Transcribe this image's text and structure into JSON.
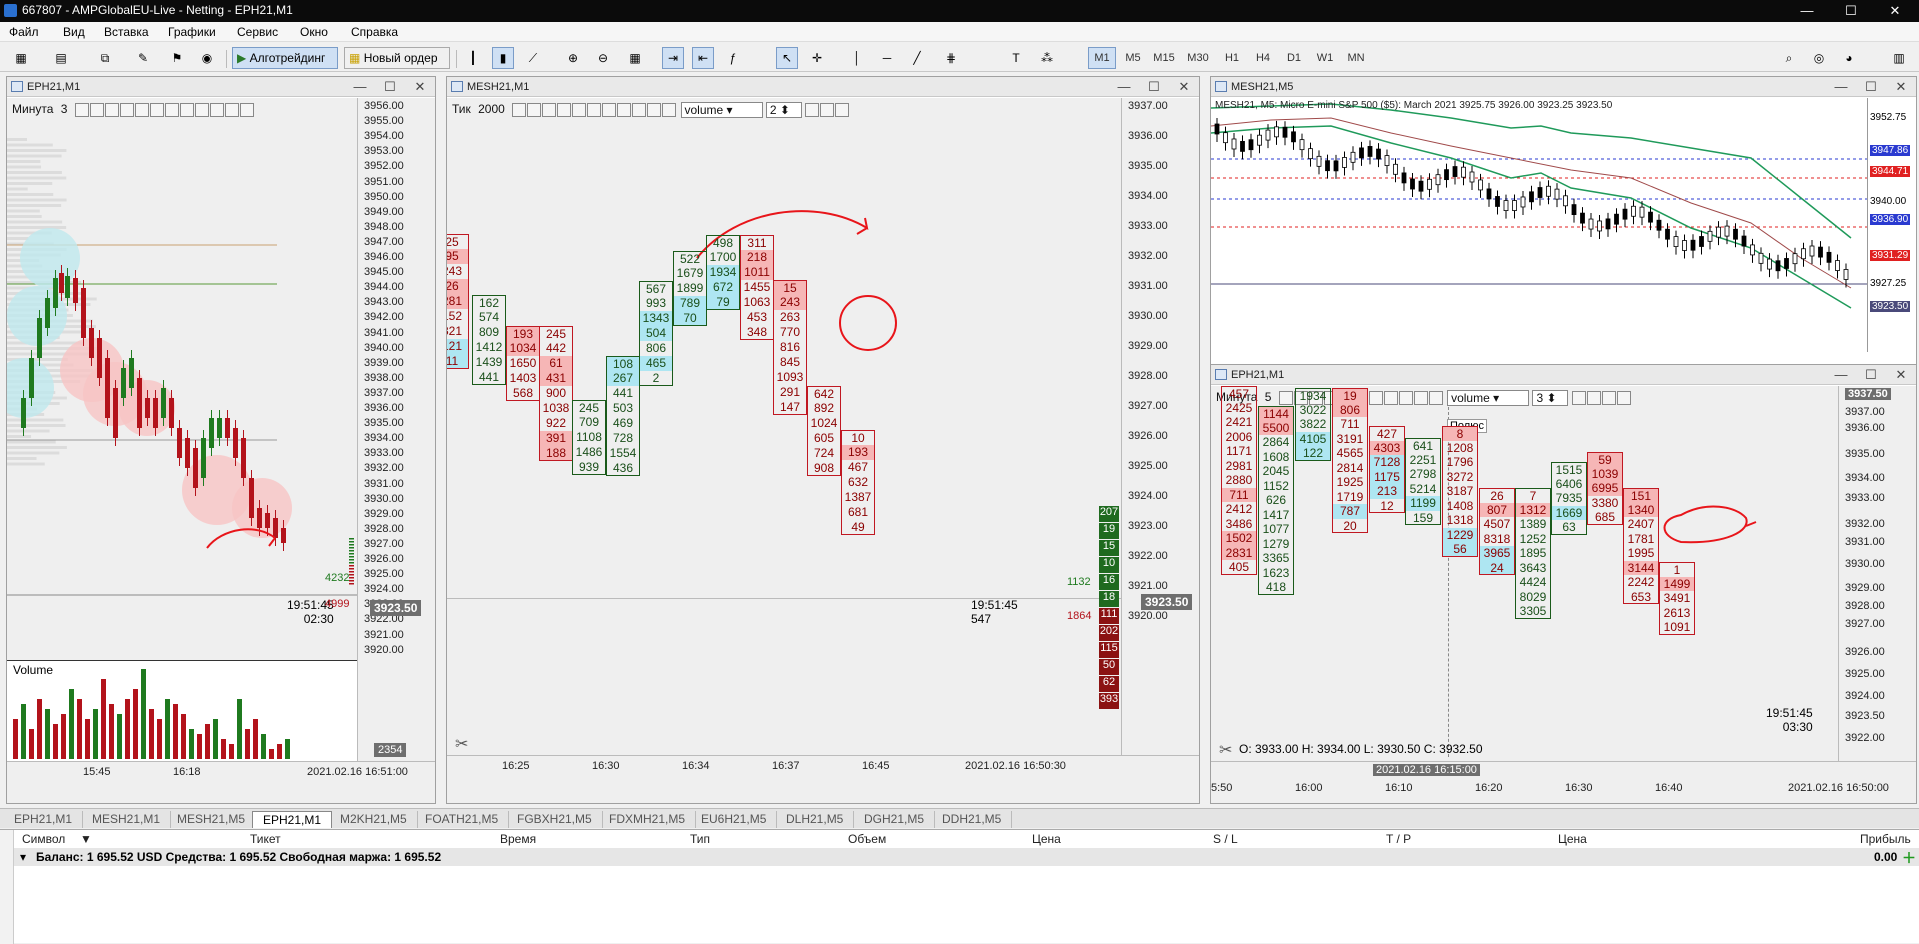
{
  "app": {
    "title": "667807 - AMPGlobalEU-Live - Netting - EPH21,M1",
    "minimize": "—",
    "maximize": "☐",
    "close": "✕"
  },
  "menu": [
    "Файл",
    "Вид",
    "Вставка",
    "Графики",
    "Сервис",
    "Окно",
    "Справка"
  ],
  "toolbar": {
    "algo_label": "Алготрейдинг",
    "new_order_label": "Новый ордер",
    "timeframes": [
      "M1",
      "M5",
      "M15",
      "M30",
      "H1",
      "H4",
      "D1",
      "W1",
      "MN"
    ],
    "active_timeframe": "M1"
  },
  "chart1": {
    "title": "EPH21,M1",
    "overlay_label": "Минута",
    "overlay_value": "3",
    "prices": [
      "3956.00",
      "3955.00",
      "3954.00",
      "3953.00",
      "3952.00",
      "3951.00",
      "3950.00",
      "3949.00",
      "3948.00",
      "3947.00",
      "3946.00",
      "3945.00",
      "3944.00",
      "3943.00",
      "3942.00",
      "3941.00",
      "3940.00",
      "3939.00",
      "3938.00",
      "3937.00",
      "3936.00",
      "3935.00",
      "3934.00",
      "3933.00",
      "3932.00",
      "3931.00",
      "3930.00",
      "3929.00",
      "3928.00",
      "3927.00",
      "3926.00",
      "3925.00",
      "3924.00",
      "3923.00",
      "3922.00",
      "3921.00",
      "3920.00"
    ],
    "current_price": "3923.50",
    "vol_buy": "4232",
    "vol_sell": "4999",
    "clock": "19:51:45",
    "countdown": "02:30",
    "volume_label": "Volume",
    "volume_value": "2354",
    "time_labels": [
      "15:45",
      "16:18"
    ],
    "datetime": "2021.02.16 16:51:00"
  },
  "chart2": {
    "title": "MESH21,M1",
    "overlay_label": "Тик",
    "overlay_value": "2000",
    "dropdown": "volume",
    "dropdown_num": "2",
    "prices": [
      "3937.00",
      "3936.00",
      "3935.00",
      "3934.00",
      "3933.00",
      "3932.00",
      "3931.00",
      "3930.00",
      "3929.00",
      "3928.00",
      "3927.00",
      "3926.00",
      "3925.00",
      "3924.00",
      "3923.00",
      "3922.00",
      "3921.00",
      "3920.00"
    ],
    "current_price": "3923.50",
    "vol_buy": "1132",
    "vol_sell": "1864",
    "dom_green": [
      "207",
      "19",
      "15",
      "10",
      "16",
      "18"
    ],
    "dom_red": [
      "111",
      "202",
      "115",
      "50",
      "62",
      "393"
    ],
    "clock": "19:51:45",
    "countdown": "547",
    "time_labels": [
      "16:25",
      "16:30",
      "16:34",
      "16:37",
      "16:45"
    ],
    "datetime": "2021.02.16 16:50:30",
    "columns": [
      {
        "cells": [
          {
            "v": "25",
            "c": "s"
          },
          {
            "v": "95",
            "c": "s hs"
          },
          {
            "v": "243",
            "c": "s"
          },
          {
            "v": "26",
            "c": "s hs"
          },
          {
            "v": "281",
            "c": "s hs"
          },
          {
            "v": "152",
            "c": "s"
          },
          {
            "v": "321",
            "c": "s"
          },
          {
            "v": "121",
            "c": "s hb"
          },
          {
            "v": "11",
            "c": "s hb"
          }
        ],
        "side": "sell"
      },
      {
        "cells": [
          {
            "v": "162",
            "c": "b"
          },
          {
            "v": "574",
            "c": "b"
          },
          {
            "v": "809",
            "c": "b"
          },
          {
            "v": "1412",
            "c": "b"
          },
          {
            "v": "1439",
            "c": "b"
          },
          {
            "v": "441",
            "c": "b"
          }
        ],
        "side": "buy"
      },
      {
        "cells": [
          {
            "v": "193",
            "c": "s hs"
          },
          {
            "v": "1034",
            "c": "s hs"
          },
          {
            "v": "1650",
            "c": "s"
          },
          {
            "v": "1403",
            "c": "s"
          },
          {
            "v": "568",
            "c": "s"
          }
        ],
        "side": "sell"
      },
      {
        "cells": [
          {
            "v": "245",
            "c": "s"
          },
          {
            "v": "442",
            "c": "s"
          },
          {
            "v": "61",
            "c": "s hs"
          },
          {
            "v": "431",
            "c": "s hs"
          },
          {
            "v": "900",
            "c": "s"
          },
          {
            "v": "1038",
            "c": "s"
          },
          {
            "v": "922",
            "c": "s"
          },
          {
            "v": "391",
            "c": "s hs"
          },
          {
            "v": "188",
            "c": "s hs"
          }
        ],
        "side": "sell"
      },
      {
        "cells": [
          {
            "v": "245",
            "c": "b"
          },
          {
            "v": "709",
            "c": "b"
          },
          {
            "v": "1108",
            "c": "b"
          },
          {
            "v": "1486",
            "c": "b"
          },
          {
            "v": "939",
            "c": "b"
          }
        ],
        "side": "buy"
      },
      {
        "cells": [
          {
            "v": "108",
            "c": "b hb"
          },
          {
            "v": "267",
            "c": "b hb"
          },
          {
            "v": "441",
            "c": "b"
          },
          {
            "v": "503",
            "c": "b"
          },
          {
            "v": "469",
            "c": "b"
          },
          {
            "v": "728",
            "c": "b"
          },
          {
            "v": "1554",
            "c": "b"
          },
          {
            "v": "436",
            "c": "b"
          }
        ],
        "side": "buy"
      },
      {
        "cells": [
          {
            "v": "567",
            "c": "b"
          },
          {
            "v": "993",
            "c": "b"
          },
          {
            "v": "1343",
            "c": "b hb"
          },
          {
            "v": "504",
            "c": "b hb"
          },
          {
            "v": "806",
            "c": "b"
          },
          {
            "v": "465",
            "c": "b hb"
          },
          {
            "v": "2",
            "c": "b"
          }
        ],
        "side": "buy"
      },
      {
        "cells": [
          {
            "v": "522",
            "c": "b"
          },
          {
            "v": "1679",
            "c": "b"
          },
          {
            "v": "1899",
            "c": "b"
          },
          {
            "v": "789",
            "c": "b hb"
          },
          {
            "v": "70",
            "c": "b hb"
          }
        ],
        "side": "buy"
      },
      {
        "cells": [
          {
            "v": "498",
            "c": "b"
          },
          {
            "v": "1700",
            "c": "b"
          },
          {
            "v": "1934",
            "c": "b hb"
          },
          {
            "v": "672",
            "c": "b hb"
          },
          {
            "v": "79",
            "c": "b hb"
          }
        ],
        "side": "buy"
      },
      {
        "cells": [
          {
            "v": "311",
            "c": "s"
          },
          {
            "v": "218",
            "c": "s hs"
          },
          {
            "v": "1011",
            "c": "s hs"
          },
          {
            "v": "1455",
            "c": "s"
          },
          {
            "v": "1063",
            "c": "s"
          },
          {
            "v": "453",
            "c": "s"
          },
          {
            "v": "348",
            "c": "s"
          }
        ],
        "side": "sell"
      },
      {
        "cells": [
          {
            "v": "15",
            "c": "s hs"
          },
          {
            "v": "243",
            "c": "s hs"
          },
          {
            "v": "263",
            "c": "s"
          },
          {
            "v": "770",
            "c": "s"
          },
          {
            "v": "816",
            "c": "s"
          },
          {
            "v": "845",
            "c": "s"
          },
          {
            "v": "1093",
            "c": "s"
          },
          {
            "v": "291",
            "c": "s"
          },
          {
            "v": "147",
            "c": "s"
          }
        ],
        "side": "sell"
      },
      {
        "cells": [
          {
            "v": "642",
            "c": "s"
          },
          {
            "v": "892",
            "c": "s"
          },
          {
            "v": "1024",
            "c": "s"
          },
          {
            "v": "605",
            "c": "s"
          },
          {
            "v": "724",
            "c": "s"
          },
          {
            "v": "908",
            "c": "s"
          }
        ],
        "side": "sell"
      },
      {
        "cells": [
          {
            "v": "10",
            "c": "s"
          },
          {
            "v": "193",
            "c": "s hs"
          },
          {
            "v": "467",
            "c": "s"
          },
          {
            "v": "632",
            "c": "s"
          },
          {
            "v": "1387",
            "c": "s"
          },
          {
            "v": "681",
            "c": "s"
          },
          {
            "v": "49",
            "c": "s"
          }
        ],
        "side": "sell"
      }
    ]
  },
  "chart3": {
    "title": "MESH21,M5",
    "info": "MESH21, M5:  Micro E-mini S&P 500 ($5): March 2021  3925.75 3926.00 3923.25 3923.50",
    "prices": [
      "3952.75",
      "3947.86",
      "3944.71",
      "3940.00",
      "3936.90",
      "3931.29",
      "3927.25",
      "3923.50"
    ],
    "time_labels": [
      "5:50",
      "16:00",
      "16:10",
      "16:20",
      "16:30",
      "16:40"
    ],
    "datetime": "2021.02.16 16:50:00"
  },
  "chart4": {
    "title": "EPH21,M1",
    "overlay_label": "Минута",
    "overlay_value": "5",
    "dropdown": "volume",
    "dropdown_num": "3",
    "tooltip": "Полюс",
    "prices": [
      "3937.50",
      "3937.00",
      "3936.00",
      "3935.00",
      "3934.00",
      "3933.00",
      "3932.00",
      "3931.00",
      "3930.00",
      "3929.00",
      "3928.00",
      "3927.00",
      "3926.00",
      "3925.00",
      "3924.00",
      "3923.50",
      "3922.00"
    ],
    "ohlc": "O: 3933.00   H: 3934.00   L: 3930.50   C: 3932.50",
    "crosshair_time": "2021.02.16 16:15:00",
    "clock": "19:51:45",
    "countdown": "03:30",
    "datetime": "2021.02.16 16:50:00",
    "columns": [
      {
        "cells": [
          {
            "v": "457",
            "c": "s"
          },
          {
            "v": "2425",
            "c": "s"
          },
          {
            "v": "2421",
            "c": "s"
          },
          {
            "v": "2006",
            "c": "s"
          },
          {
            "v": "1171",
            "c": "s"
          },
          {
            "v": "2981",
            "c": "s"
          },
          {
            "v": "2880",
            "c": "s"
          },
          {
            "v": "711",
            "c": "s hs"
          },
          {
            "v": "2412",
            "c": "s"
          },
          {
            "v": "3486",
            "c": "s"
          },
          {
            "v": "1502",
            "c": "s hs"
          },
          {
            "v": "2831",
            "c": "s hs"
          },
          {
            "v": "405",
            "c": "s"
          }
        ],
        "side": "sell"
      },
      {
        "cells": [
          {
            "v": "1144",
            "c": "s hs"
          },
          {
            "v": "5500",
            "c": "s hs"
          },
          {
            "v": "2864",
            "c": "b"
          },
          {
            "v": "1608",
            "c": "b"
          },
          {
            "v": "2045",
            "c": "b"
          },
          {
            "v": "1152",
            "c": "b"
          },
          {
            "v": "626",
            "c": "b"
          },
          {
            "v": "1417",
            "c": "b"
          },
          {
            "v": "1077",
            "c": "b"
          },
          {
            "v": "1279",
            "c": "b"
          },
          {
            "v": "3365",
            "c": "b"
          },
          {
            "v": "1623",
            "c": "b"
          },
          {
            "v": "418",
            "c": "b"
          }
        ],
        "side": "buy"
      },
      {
        "cells": [
          {
            "v": "1934",
            "c": "b"
          },
          {
            "v": "3022",
            "c": "b"
          },
          {
            "v": "3822",
            "c": "b"
          },
          {
            "v": "4105",
            "c": "b hb"
          },
          {
            "v": "122",
            "c": "b hb"
          }
        ],
        "side": "buy"
      },
      {
        "cells": [
          {
            "v": "19",
            "c": "s hs"
          },
          {
            "v": "806",
            "c": "s hs"
          },
          {
            "v": "711",
            "c": "s"
          },
          {
            "v": "3191",
            "c": "s"
          },
          {
            "v": "4565",
            "c": "s"
          },
          {
            "v": "2814",
            "c": "s"
          },
          {
            "v": "1925",
            "c": "s"
          },
          {
            "v": "1719",
            "c": "s"
          },
          {
            "v": "787",
            "c": "s hb"
          },
          {
            "v": "20",
            "c": "s"
          }
        ],
        "side": "sell"
      },
      {
        "cells": [
          {
            "v": "427",
            "c": "s"
          },
          {
            "v": "4303",
            "c": "s hs"
          },
          {
            "v": "7128",
            "c": "s hb"
          },
          {
            "v": "1175",
            "c": "s hb"
          },
          {
            "v": "213",
            "c": "s hb"
          },
          {
            "v": "12",
            "c": "s"
          }
        ],
        "side": "sell"
      },
      {
        "cells": [
          {
            "v": "641",
            "c": "b"
          },
          {
            "v": "2251",
            "c": "b"
          },
          {
            "v": "2798",
            "c": "b"
          },
          {
            "v": "5214",
            "c": "b"
          },
          {
            "v": "1199",
            "c": "b hb"
          },
          {
            "v": "159",
            "c": "b"
          }
        ],
        "side": "buy"
      },
      {
        "cells": [
          {
            "v": "8",
            "c": "s hs"
          },
          {
            "v": "1208",
            "c": "s"
          },
          {
            "v": "1796",
            "c": "s"
          },
          {
            "v": "3272",
            "c": "s"
          },
          {
            "v": "3187",
            "c": "s"
          },
          {
            "v": "1408",
            "c": "s"
          },
          {
            "v": "1318",
            "c": "s"
          },
          {
            "v": "1229",
            "c": "s hb"
          },
          {
            "v": "56",
            "c": "s hb"
          }
        ],
        "side": "sell"
      },
      {
        "cells": [
          {
            "v": "26",
            "c": "s"
          },
          {
            "v": "807",
            "c": "s hs"
          },
          {
            "v": "4507",
            "c": "s"
          },
          {
            "v": "8318",
            "c": "s"
          },
          {
            "v": "3965",
            "c": "s hb"
          },
          {
            "v": "24",
            "c": "s hb"
          }
        ],
        "side": "sell"
      },
      {
        "cells": [
          {
            "v": "7",
            "c": "s"
          },
          {
            "v": "1312",
            "c": "s hs"
          },
          {
            "v": "1389",
            "c": "b"
          },
          {
            "v": "1252",
            "c": "b"
          },
          {
            "v": "1895",
            "c": "b"
          },
          {
            "v": "3643",
            "c": "b"
          },
          {
            "v": "4424",
            "c": "b"
          },
          {
            "v": "8029",
            "c": "b"
          },
          {
            "v": "3305",
            "c": "b"
          }
        ],
        "side": "buy"
      },
      {
        "cells": [
          {
            "v": "1515",
            "c": "b"
          },
          {
            "v": "6406",
            "c": "b"
          },
          {
            "v": "7935",
            "c": "b"
          },
          {
            "v": "1669",
            "c": "b hb"
          },
          {
            "v": "63",
            "c": "b"
          }
        ],
        "side": "buy"
      },
      {
        "cells": [
          {
            "v": "59",
            "c": "s hs"
          },
          {
            "v": "1039",
            "c": "s hs"
          },
          {
            "v": "6995",
            "c": "s hs"
          },
          {
            "v": "3380",
            "c": "s"
          },
          {
            "v": "685",
            "c": "s"
          }
        ],
        "side": "sell"
      },
      {
        "cells": [
          {
            "v": "151",
            "c": "s hs"
          },
          {
            "v": "1340",
            "c": "s hs"
          },
          {
            "v": "2407",
            "c": "s"
          },
          {
            "v": "1781",
            "c": "s"
          },
          {
            "v": "1995",
            "c": "s"
          },
          {
            "v": "3144",
            "c": "s hs"
          },
          {
            "v": "2242",
            "c": "s"
          },
          {
            "v": "653",
            "c": "s"
          }
        ],
        "side": "sell"
      },
      {
        "cells": [
          {
            "v": "1",
            "c": "s"
          },
          {
            "v": "1499",
            "c": "s hs"
          },
          {
            "v": "3491",
            "c": "s"
          },
          {
            "v": "2613",
            "c": "s"
          },
          {
            "v": "1091",
            "c": "s"
          }
        ],
        "side": "sell"
      }
    ]
  },
  "tabs": [
    "EPH21,M1",
    "MESH21,M1",
    "MESH21,M5",
    "EPH21,M1",
    "M2KH21,M5",
    "FOATH21,M5",
    "FGBXH21,M5",
    "FDXMH21,M5",
    "EU6H21,M5",
    "DLH21,M5",
    "DGH21,M5",
    "DDH21,M5"
  ],
  "active_tab": 3,
  "terminal": {
    "headers": [
      "Символ",
      "Тикет",
      "Время",
      "Тип",
      "Объем",
      "Цена",
      "S / L",
      "T / P",
      "Цена",
      "Прибыль"
    ],
    "balance": "Баланс: 1 695.52 USD  Средства: 1 695.52  Свободная маржа: 1 695.52",
    "profit": "0.00"
  },
  "colors": {
    "bull": "#1f7a1f",
    "bear": "#b3131b",
    "highlight_sell": "#f6b6b6",
    "highlight_buy": "#aee6f2"
  }
}
